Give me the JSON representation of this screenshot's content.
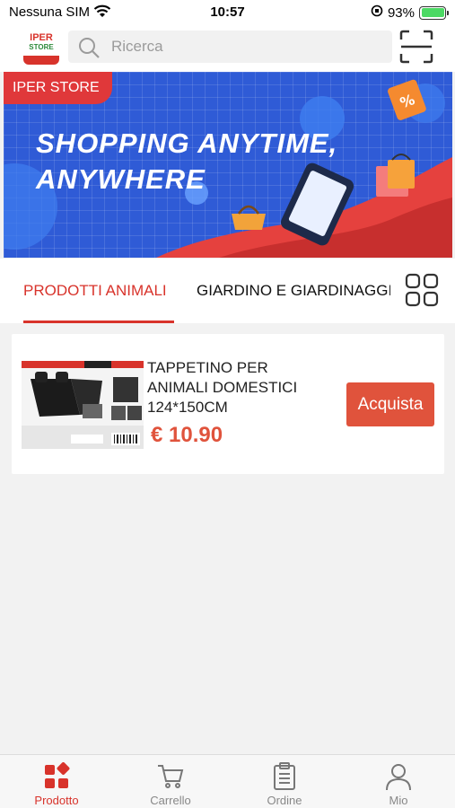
{
  "status_bar": {
    "carrier": "Nessuna SIM",
    "time": "10:57",
    "battery": "93%"
  },
  "header": {
    "logo": {
      "line1": "IPER",
      "line2": "STORE"
    },
    "search_placeholder": "Ricerca",
    "scan_icon": "scan-icon"
  },
  "banner": {
    "tag": "IPER STORE",
    "headline_line1": "SHOPPING ANYTIME,",
    "headline_line2": "ANYWHERE"
  },
  "tabs": [
    {
      "label": "PRODOTTI ANIMALI",
      "active": true
    },
    {
      "label": "GIARDINO E GIARDINAGGIO",
      "active": false
    }
  ],
  "products": [
    {
      "name": "TAPPETINO PER ANIMALI DOMESTICI 124*150CM",
      "price": "€ 10.90",
      "button": "Acquista"
    }
  ],
  "tabbar": [
    {
      "label": "Prodotto",
      "icon": "grid-icon",
      "active": true
    },
    {
      "label": "Carrello",
      "icon": "cart-icon",
      "active": false
    },
    {
      "label": "Ordine",
      "icon": "clipboard-icon",
      "active": false
    },
    {
      "label": "Mio",
      "icon": "user-icon",
      "active": false
    }
  ],
  "colors": {
    "accent": "#d8332b",
    "price": "#e0533c",
    "banner_blue": "#2f5bd6"
  }
}
